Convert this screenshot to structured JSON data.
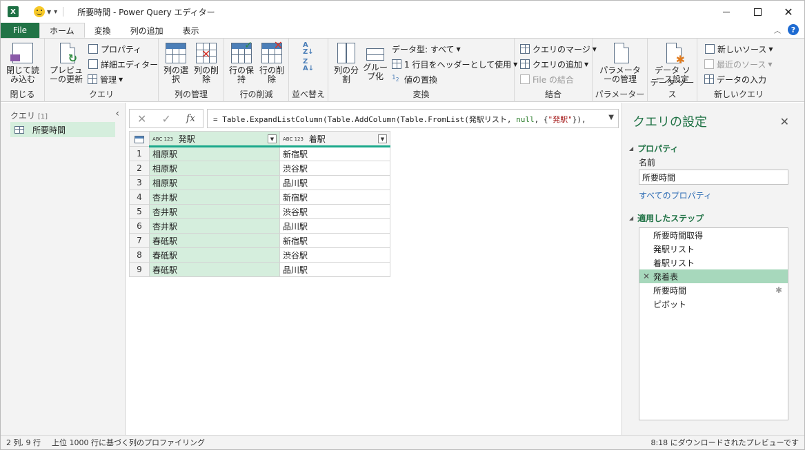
{
  "window": {
    "title": "所要時間 - Power Query エディター",
    "app_icon": "X",
    "qat_icons": [
      "excel-icon",
      "smiley-icon",
      "customize-qat-icon"
    ]
  },
  "tabs": [
    {
      "label": "File"
    },
    {
      "label": "ホーム"
    },
    {
      "label": "変換"
    },
    {
      "label": "列の追加"
    },
    {
      "label": "表示"
    }
  ],
  "help_label": "?",
  "ribbon": {
    "groups": {
      "close": {
        "label": "閉じる",
        "close_load": "閉じて読み込む"
      },
      "query": {
        "label": "クエリ",
        "preview_refresh": "プレビューの更新",
        "properties": "プロパティ",
        "advanced_editor": "詳細エディター",
        "manage": "管理"
      },
      "columns": {
        "label": "列の管理",
        "choose": "列の選択",
        "remove": "列の削除"
      },
      "rows": {
        "label": "行の削減",
        "keep": "行の保持",
        "remove": "行の削除"
      },
      "sort": {
        "label": "並べ替え"
      },
      "transform": {
        "label": "変換",
        "split": "列の分割",
        "group_by": "グループ化",
        "data_type": "データ型: すべて",
        "first_row_header": "1 行目をヘッダーとして使用",
        "replace_values": "値の置換"
      },
      "combine": {
        "label": "結合",
        "merge": "クエリのマージ",
        "append": "クエリの追加",
        "combine_files": "File の結合"
      },
      "parameters": {
        "label": "パラメーター",
        "manage": "パラメーターの管理"
      },
      "data_source": {
        "label": "データ ソース",
        "settings": "データ ソース設定"
      },
      "new_query": {
        "label": "新しいクエリ",
        "new_source": "新しいソース",
        "recent_source": "最近のソース",
        "enter_data": "データの入力"
      }
    }
  },
  "queries_pane": {
    "header": "クエリ",
    "count": "[1]",
    "items": [
      "所要時間"
    ]
  },
  "formula": {
    "prefix": "= Table.ExpandListColumn(Table.AddColumn(Table.FromList(発駅リスト, ",
    "null_kw": "null",
    "mid": ", {",
    "str": "\"発駅\"",
    "suffix": "}),"
  },
  "table": {
    "columns": [
      {
        "type": "ABC 123",
        "name": "発駅"
      },
      {
        "type": "ABC 123",
        "name": "着駅"
      }
    ],
    "rows": [
      [
        "1",
        "相原駅",
        "新宿駅"
      ],
      [
        "2",
        "相原駅",
        "渋谷駅"
      ],
      [
        "3",
        "相原駅",
        "品川駅"
      ],
      [
        "4",
        "杏井駅",
        "新宿駅"
      ],
      [
        "5",
        "杏井駅",
        "渋谷駅"
      ],
      [
        "6",
        "杏井駅",
        "品川駅"
      ],
      [
        "7",
        "春砥駅",
        "新宿駅"
      ],
      [
        "8",
        "春砥駅",
        "渋谷駅"
      ],
      [
        "9",
        "春砥駅",
        "品川駅"
      ]
    ]
  },
  "settings_pane": {
    "title": "クエリの設定",
    "properties_header": "プロパティ",
    "name_label": "名前",
    "name_value": "所要時間",
    "all_properties": "すべてのプロパティ",
    "steps_header": "適用したステップ",
    "steps": [
      "所要時間取得",
      "発駅リスト",
      "着駅リスト",
      "発着表",
      "所要時間",
      "ピボット"
    ],
    "selected_step": 3
  },
  "status": {
    "left": "2 列, 9 行",
    "middle": "上位 1000 行に基づく列のプロファイリング",
    "right": "8:18 にダウンロードされたプレビューです"
  },
  "colors": {
    "accent": "#217346",
    "selected_column": "#d5eedd",
    "selected_step": "#a7d8bc",
    "header_underline": "#1aa88a",
    "link": "#2a6ab3"
  }
}
